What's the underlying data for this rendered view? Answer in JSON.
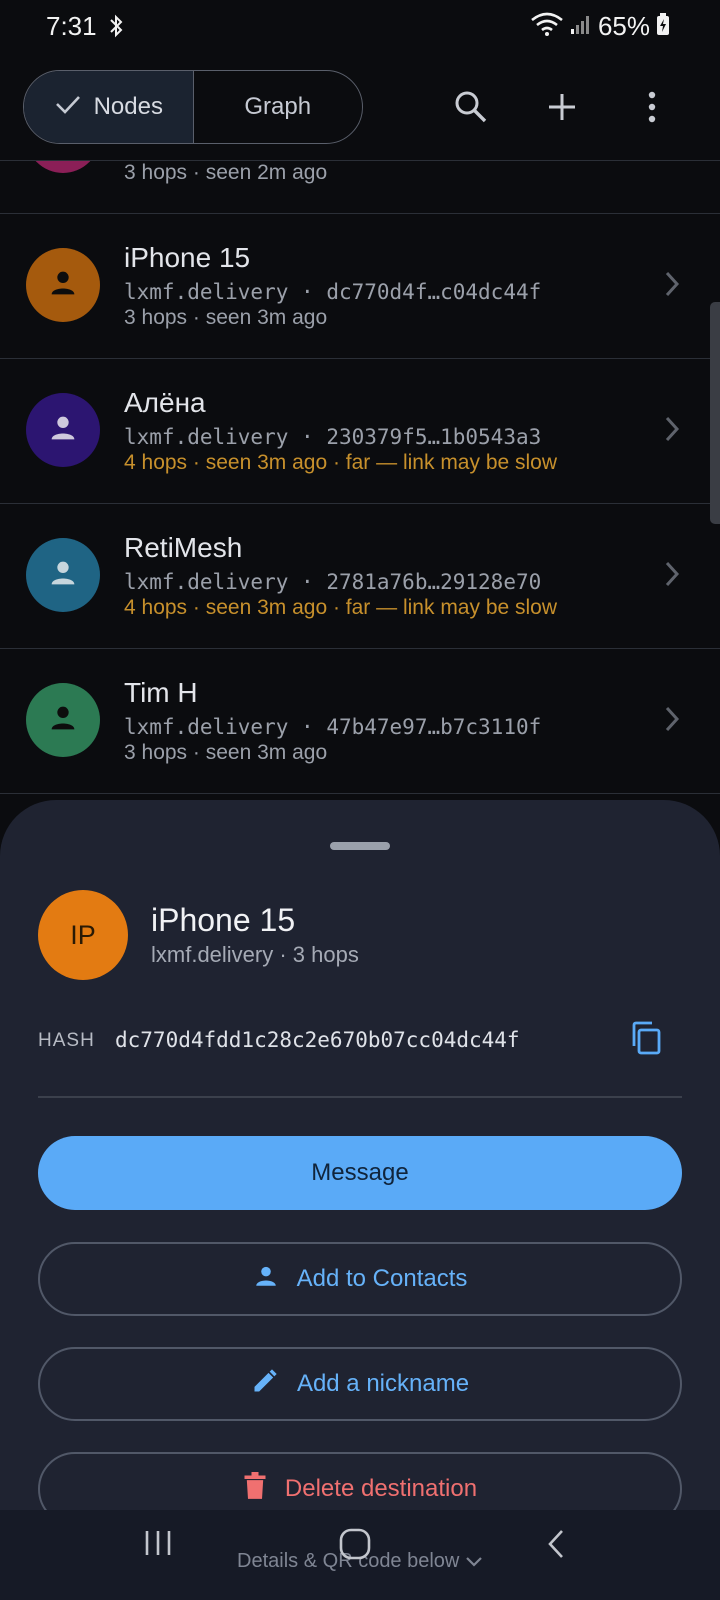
{
  "status_bar": {
    "time": "7:31",
    "battery": "65%",
    "icons": [
      "bluetooth-icon",
      "wifi-icon",
      "signal-icon",
      "battery-charging-icon"
    ]
  },
  "toolbar": {
    "tabs": [
      {
        "label": "Nodes",
        "selected": true
      },
      {
        "label": "Graph",
        "selected": false
      }
    ],
    "actions": [
      "search-icon",
      "add-icon",
      "more-vert-icon"
    ]
  },
  "nodes": {
    "partial_meta": "3 hops · seen 2m ago",
    "items": [
      {
        "name": "iPhone 15",
        "aspect": "lxmf.delivery",
        "hash_short": "dc770d4f…c04dc44f",
        "meta": "3 hops · seen 3m ago",
        "warn": false,
        "avatar_color": "#a55a0d"
      },
      {
        "name": "Алёна",
        "aspect": "lxmf.delivery",
        "hash_short": "230379f5…1b0543a3",
        "meta": "4 hops · seen 3m ago · far — link may be slow",
        "warn": true,
        "avatar_color": "#2c1571"
      },
      {
        "name": "RetiMesh",
        "aspect": "lxmf.delivery",
        "hash_short": "2781a76b…29128e70",
        "meta": "4 hops · seen 3m ago · far — link may be slow",
        "warn": true,
        "avatar_color": "#1f6484"
      },
      {
        "name": "Tim H",
        "aspect": "lxmf.delivery",
        "hash_short": "47b47e97…b7c3110f",
        "meta": "3 hops · seen 3m ago",
        "warn": false,
        "avatar_color": "#2c7a53"
      }
    ],
    "separator": " · "
  },
  "sheet": {
    "avatar_initials": "IP",
    "title": "iPhone 15",
    "subtitle": "lxmf.delivery · 3 hops",
    "hash_label": "HASH",
    "hash_value": "dc770d4fdd1c28c2e670b07cc04dc44f",
    "message_label": "Message",
    "add_contacts_label": "Add to Contacts",
    "nickname_label": "Add a nickname",
    "delete_label": "Delete destination"
  },
  "navbar": {
    "hint": "Details & QR code below"
  },
  "colors": {
    "accent": "#5aaaf7",
    "warning": "#c7902c",
    "danger": "#f07070",
    "sheet_bg": "#1f2331"
  }
}
